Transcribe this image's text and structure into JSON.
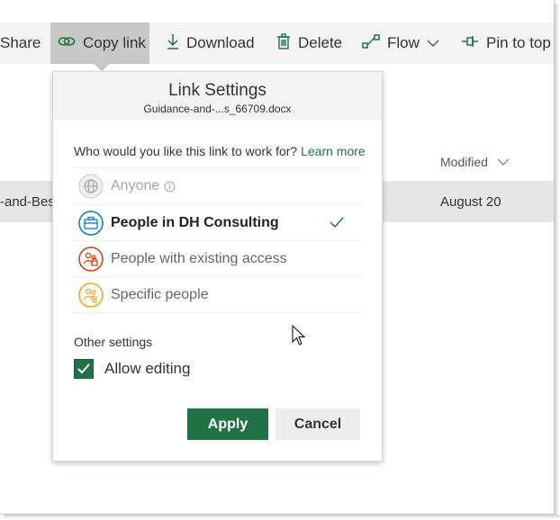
{
  "toolbar": {
    "share_label": "Share",
    "copy_link_label": "Copy link",
    "download_label": "Download",
    "delete_label": "Delete",
    "flow_label": "Flow",
    "pin_label": "Pin to top"
  },
  "list": {
    "modified_header": "Modified",
    "row_name_fragment": "-and-Bes",
    "row_modified": "August 20"
  },
  "dialog": {
    "title": "Link Settings",
    "filename": "Guidance-and-...s_66709.docx",
    "question": "Who would you like this link to work for?",
    "learn_more": "Learn more",
    "options": [
      {
        "label": "Anyone",
        "icon": "globe-icon",
        "state": "disabled"
      },
      {
        "label": "People in DH Consulting",
        "icon": "briefcase-icon",
        "state": "selected"
      },
      {
        "label": "People with existing access",
        "icon": "people-lock-icon",
        "state": "normal"
      },
      {
        "label": "Specific people",
        "icon": "people-icon",
        "state": "normal"
      }
    ],
    "other_settings_label": "Other settings",
    "allow_editing_label": "Allow editing",
    "allow_editing_checked": true,
    "apply_label": "Apply",
    "cancel_label": "Cancel"
  },
  "colors": {
    "accent": "#217346",
    "selected_icon": "#0078d4",
    "existing_access_icon": "#d83b01",
    "specific_people_icon": "#f7a11a"
  }
}
